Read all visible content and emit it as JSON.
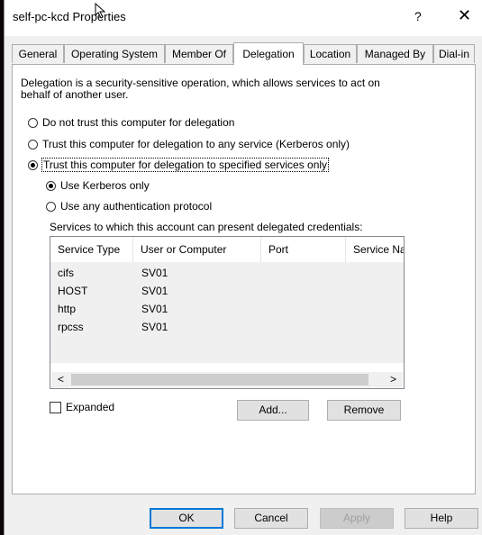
{
  "window": {
    "title": "self-pc-kcd Properties",
    "help": "?",
    "close": "✕"
  },
  "tabs": [
    {
      "label": "General"
    },
    {
      "label": "Operating System"
    },
    {
      "label": "Member Of"
    },
    {
      "label": "Delegation",
      "active": true
    },
    {
      "label": "Location"
    },
    {
      "label": "Managed By"
    },
    {
      "label": "Dial-in"
    }
  ],
  "delegation": {
    "description": "Delegation is a security-sensitive operation, which allows services to act on behalf of another user.",
    "options": [
      {
        "label": "Do not trust this computer for delegation",
        "checked": false
      },
      {
        "label": "Trust this computer for delegation to any service (Kerberos only)",
        "checked": false
      },
      {
        "label": "Trust this computer for delegation to specified services only",
        "checked": true
      }
    ],
    "sub_options": [
      {
        "label": "Use Kerberos only",
        "checked": true
      },
      {
        "label": "Use any authentication protocol",
        "checked": false
      }
    ],
    "services_label": "Services to which this account can present delegated credentials:",
    "columns": [
      "Service Type",
      "User or Computer",
      "Port",
      "Service Na"
    ],
    "rows": [
      [
        "cifs",
        "SV01"
      ],
      [
        "HOST",
        "SV01"
      ],
      [
        "http",
        "SV01"
      ],
      [
        "rpcss",
        "SV01"
      ]
    ],
    "scroll_left": "<",
    "scroll_right": ">",
    "expanded_label": "Expanded",
    "expanded_checked": false,
    "add_label": "Add...",
    "remove_label": "Remove"
  },
  "footer": {
    "ok": "OK",
    "cancel": "Cancel",
    "apply": "Apply",
    "help": "Help"
  },
  "colors": {
    "dialog_bg": "#f0f0f0",
    "focus_border": "#0078d7"
  }
}
